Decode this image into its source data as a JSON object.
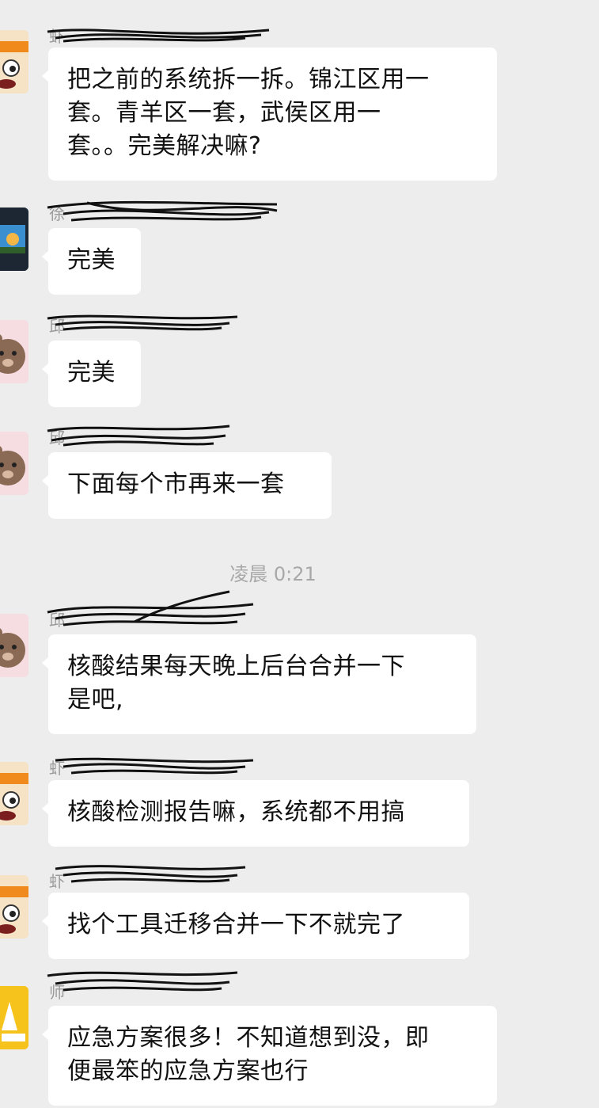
{
  "chat": {
    "timestamp": "凌晨 0:21",
    "messages": [
      {
        "sender": "虾",
        "avatar": "cartoon-face-avatar",
        "lines": [
          "把之前的系统拆一拆。锦江区用一",
          "套。青羊区一套，武侯区用一",
          "套。。完美解决嘛?"
        ]
      },
      {
        "sender": "徐",
        "avatar": "game-screenshot-avatar",
        "lines": [
          "完美"
        ]
      },
      {
        "sender": "邱",
        "avatar": "bear-avatar",
        "lines": [
          "完美"
        ]
      },
      {
        "sender": "邱",
        "avatar": "bear-avatar",
        "lines": [
          "下面每个市再来一套"
        ]
      },
      {
        "sender": "邱",
        "avatar": "bear-avatar",
        "lines": [
          "核酸结果每天晚上后台合并一下",
          "是吧,"
        ]
      },
      {
        "sender": "虾",
        "avatar": "cartoon-face-avatar",
        "lines": [
          "核酸检测报告嘛，系统都不用搞"
        ]
      },
      {
        "sender": "虾",
        "avatar": "cartoon-face-avatar",
        "lines": [
          "找个工具迁移合并一下不就完了"
        ]
      },
      {
        "sender": "师",
        "avatar": "yellow-logo-avatar",
        "lines": [
          "应急方案很多！不知道想到没，即",
          "便最笨的应急方案也行"
        ]
      }
    ]
  },
  "colors": {
    "background": "#ededed",
    "bubble": "#ffffff",
    "text": "#111111",
    "meta": "#a8a8a8"
  }
}
